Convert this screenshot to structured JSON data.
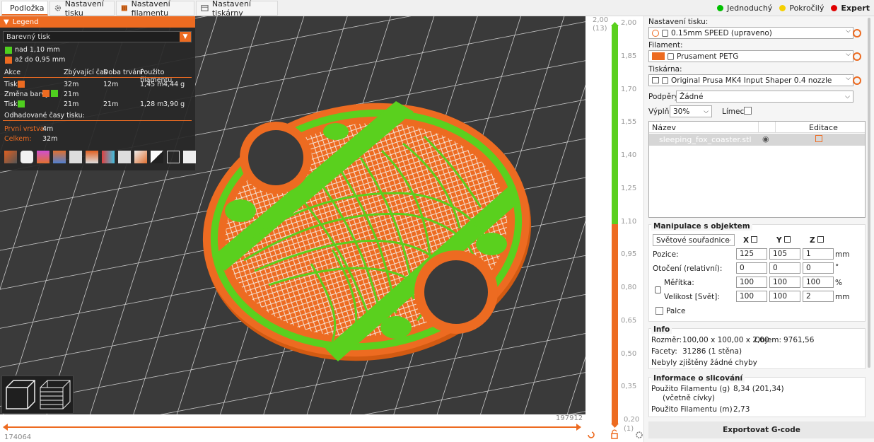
{
  "tabs": [
    {
      "label": "Podložka",
      "icon": "plater-icon",
      "active": true
    },
    {
      "label": "Nastavení tisku",
      "icon": "gear-icon",
      "active": false
    },
    {
      "label": "Nastavení filamentu",
      "icon": "spool-icon",
      "active": false
    },
    {
      "label": "Nastavení tiskárny",
      "icon": "printer-icon",
      "active": false
    }
  ],
  "modes": [
    {
      "label": "Jednoduchý",
      "color": "#00c000"
    },
    {
      "label": "Pokročilý",
      "color": "#f5d000"
    },
    {
      "label": "Expert",
      "color": "#e00000",
      "active": true
    }
  ],
  "legend": {
    "title": "Legend",
    "view_type": "Barevný tisk",
    "ranges": [
      {
        "label": "nad 1,10 mm",
        "color": "#4fcf1f"
      },
      {
        "label": "až do 0,95 mm",
        "color": "#ed6b21"
      }
    ],
    "headers": {
      "action": "Akce",
      "remaining": "Zbývající čas",
      "duration": "Doba trvání",
      "filament": "Použito filamentu"
    },
    "rows": [
      {
        "action": "Tisk",
        "remaining": "32m",
        "duration": "12m",
        "len": "1,45 m",
        "weight": "4,44 g"
      },
      {
        "action": "Změna barvy",
        "remaining": "21m",
        "duration": "",
        "len": "",
        "weight": ""
      },
      {
        "action": "Tisk",
        "remaining": "21m",
        "duration": "21m",
        "len": "1,28 m",
        "weight": "3,90 g"
      }
    ],
    "estimated_label": "Odhadované časy tisku:",
    "first_layer_label": "První vrstva:",
    "first_layer_value": "4m",
    "total_label": "Celkem:",
    "total_value": "32m"
  },
  "hslider": {
    "left_value": "174064",
    "right_value": "197912"
  },
  "vslider": {
    "top_value": "2,00",
    "top_layer": "(13)",
    "bottom_value": "0,20",
    "bottom_layer": "(1)",
    "ticks": [
      "2,00",
      "1,85",
      "1,70",
      "1,55",
      "1,40",
      "1,25",
      "1,10",
      "0,95",
      "0,80",
      "0,65",
      "0,50",
      "0,35",
      "0,20"
    ]
  },
  "right_panel": {
    "print_settings_label": "Nastavení tisku:",
    "print_settings_value": "0.15mm SPEED (upraveno)",
    "filament_label": "Filament:",
    "filament_value": "Prusament PETG",
    "filament_color": "#ed6b21",
    "printer_label": "Tiskárna:",
    "printer_value": "Original Prusa MK4 Input Shaper 0.4 nozzle",
    "supports_label": "Podpěry:",
    "supports_value": "Žádné",
    "infill_label": "Výplň:",
    "infill_value": "30%",
    "brim_label": "Límec:",
    "objlist_name_header": "Název",
    "objlist_edit_header": "Editace",
    "object_name": "sleeping_fox_coaster.stl",
    "manip_title": "Manipulace s objektem",
    "coord_system": "Světové souřadnice",
    "axis_x": "X",
    "axis_y": "Y",
    "axis_z": "Z",
    "position_label": "Pozice:",
    "position": [
      "125",
      "105",
      "1"
    ],
    "position_unit": "mm",
    "rotation_label": "Otočení (relativní):",
    "rotation": [
      "0",
      "0",
      "0"
    ],
    "rotation_unit": "°",
    "scale_label": "Měřítka:",
    "scale": [
      "100",
      "100",
      "100"
    ],
    "scale_unit": "%",
    "size_label": "Velikost [Svět]:",
    "size": [
      "100",
      "100",
      "2"
    ],
    "size_unit": "mm",
    "inches_label": "Palce",
    "info_title": "Info",
    "size_info_label": "Rozměr:",
    "size_info_value": "100,00 x 100,00 x 2,00",
    "volume_label": "Objem:",
    "volume_value": "9761,56",
    "facets_label": "Facety:",
    "facets_value": "31286 (1 stěna)",
    "errors_text": "Nebyly zjištěny žádné chyby",
    "slice_title": "Informace o slicování",
    "used_g_label": "Použito Filamentu (g)",
    "used_g_sub": "(včetně cívky)",
    "used_g_value": "8,34 (201,34)",
    "used_m_label": "Použito Filamentu (m)",
    "used_m_value": "2,73",
    "export_label": "Exportovat G-code"
  }
}
